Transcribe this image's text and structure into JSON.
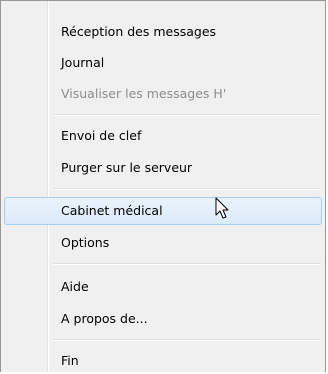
{
  "menu": {
    "group1": [
      {
        "label": "Réception des messages",
        "disabled": false
      },
      {
        "label": "Journal",
        "disabled": false
      },
      {
        "label": "Visualiser les messages H'",
        "disabled": true
      }
    ],
    "group2": [
      {
        "label": "Envoi de clef",
        "disabled": false
      },
      {
        "label": "Purger sur le serveur",
        "disabled": false
      }
    ],
    "group3": [
      {
        "label": "Cabinet médical",
        "disabled": false,
        "hovered": true
      },
      {
        "label": "Options",
        "disabled": false
      }
    ],
    "group4": [
      {
        "label": "Aide",
        "disabled": false
      },
      {
        "label": "A propos de...",
        "disabled": false
      }
    ],
    "group5": [
      {
        "label": "Fin",
        "disabled": false
      }
    ]
  },
  "cursor": {
    "icon": "mouse-pointer-icon"
  }
}
